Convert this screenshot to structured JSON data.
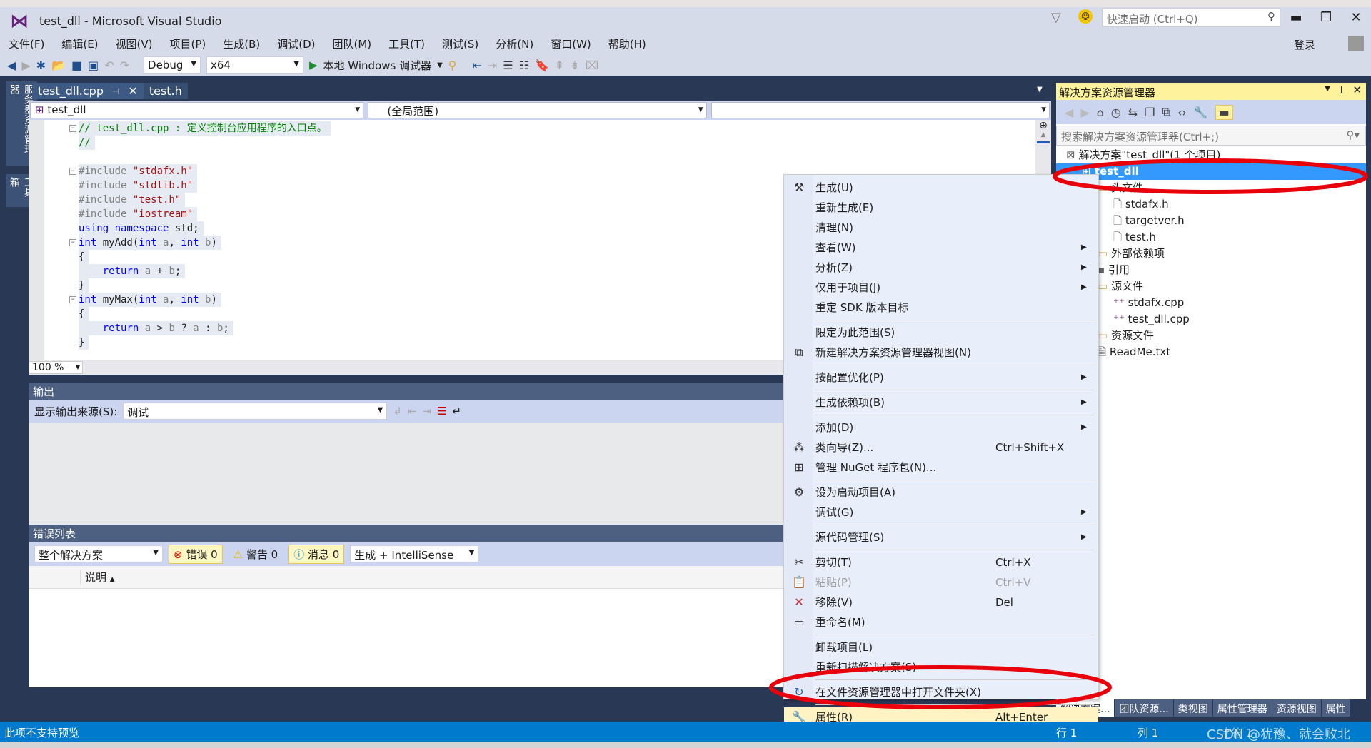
{
  "window": {
    "title": "test_dll - Microsoft Visual Studio",
    "quick_launch_placeholder": "快速启动 (Ctrl+Q)",
    "sign_in": "登录"
  },
  "menu": [
    "文件(F)",
    "编辑(E)",
    "视图(V)",
    "项目(P)",
    "生成(B)",
    "调试(D)",
    "团队(M)",
    "工具(T)",
    "测试(S)",
    "分析(N)",
    "窗口(W)",
    "帮助(H)"
  ],
  "toolbar": {
    "config": "Debug",
    "platform": "x64",
    "debugger": "本地 Windows 调试器"
  },
  "side_tabs": [
    "服务器资源管理器",
    "工具箱"
  ],
  "editor": {
    "tabs": [
      {
        "label": "test_dll.cpp",
        "active": true
      },
      {
        "label": "test.h",
        "active": false
      }
    ],
    "nav": {
      "project": "test_dll",
      "scope": "(全局范围)",
      "member": ""
    },
    "zoom": "100 %",
    "lines": [
      [
        [
          "cm",
          "// test_dll.cpp : 定义控制台应用程序的入口点。"
        ]
      ],
      [
        [
          "cm",
          "//"
        ]
      ],
      [],
      [
        [
          "pp",
          "#include "
        ],
        [
          "st",
          "\"stdafx.h\""
        ]
      ],
      [
        [
          "pp",
          "#include "
        ],
        [
          "st",
          "\"stdlib.h\""
        ]
      ],
      [
        [
          "pp",
          "#include "
        ],
        [
          "st",
          "\"test.h\""
        ]
      ],
      [
        [
          "pp",
          "#include "
        ],
        [
          "st",
          "\"iostream\""
        ]
      ],
      [
        [
          "kw",
          "using namespace "
        ],
        [
          "",
          "std;"
        ]
      ],
      [
        [
          "kw",
          "int "
        ],
        [
          "",
          "myAdd("
        ],
        [
          "kw",
          "int "
        ],
        [
          "pa",
          "a"
        ],
        [
          "",
          ", "
        ],
        [
          "kw",
          "int "
        ],
        [
          "pa",
          "b"
        ],
        [
          "",
          ")"
        ]
      ],
      [
        [
          "",
          "{"
        ]
      ],
      [
        [
          "",
          "    "
        ],
        [
          "kw",
          "return "
        ],
        [
          "pa",
          "a"
        ],
        [
          "",
          " + "
        ],
        [
          "pa",
          "b"
        ],
        [
          "",
          ";"
        ]
      ],
      [
        [
          "",
          "}"
        ]
      ],
      [
        [
          "kw",
          "int "
        ],
        [
          "",
          "myMax("
        ],
        [
          "kw",
          "int "
        ],
        [
          "pa",
          "a"
        ],
        [
          "",
          ", "
        ],
        [
          "kw",
          "int "
        ],
        [
          "pa",
          "b"
        ],
        [
          "",
          ")"
        ]
      ],
      [
        [
          "",
          "{"
        ]
      ],
      [
        [
          "",
          "    "
        ],
        [
          "kw",
          "return "
        ],
        [
          "pa",
          "a"
        ],
        [
          "",
          " > "
        ],
        [
          "pa",
          "b"
        ],
        [
          "",
          " ? "
        ],
        [
          "pa",
          "a"
        ],
        [
          "",
          " : "
        ],
        [
          "pa",
          "b"
        ],
        [
          "",
          ";"
        ]
      ],
      [
        [
          "",
          "}"
        ]
      ]
    ]
  },
  "output": {
    "title": "输出",
    "source_label": "显示输出来源(S):",
    "source": "调试"
  },
  "error_list": {
    "title": "错误列表",
    "scope": "整个解决方案",
    "errors": "错误 0",
    "warnings": "警告 0",
    "messages": "消息 0",
    "filter": "生成 + IntelliSense",
    "column": "说明"
  },
  "solution_explorer": {
    "title": "解决方案资源管理器",
    "search_placeholder": "搜索解决方案资源管理器(Ctrl+;)",
    "tree": [
      {
        "label": "解决方案\"test_dll\"(1 个项目)",
        "depth": 0,
        "icon": "solution-icon"
      },
      {
        "label": "test_dll",
        "depth": 1,
        "icon": "project-icon",
        "selected": true
      },
      {
        "label": "头文件",
        "depth": 2,
        "icon": "folder-icon"
      },
      {
        "label": "stdafx.h",
        "depth": 3,
        "icon": "header-file-icon"
      },
      {
        "label": "targetver.h",
        "depth": 3,
        "icon": "header-file-icon"
      },
      {
        "label": "test.h",
        "depth": 3,
        "icon": "header-file-icon"
      },
      {
        "label": "外部依赖项",
        "depth": 2,
        "icon": "folder-icon"
      },
      {
        "label": "引用",
        "depth": 2,
        "icon": "references-icon"
      },
      {
        "label": "源文件",
        "depth": 2,
        "icon": "folder-icon"
      },
      {
        "label": "stdafx.cpp",
        "depth": 3,
        "icon": "cpp-file-icon"
      },
      {
        "label": "test_dll.cpp",
        "depth": 3,
        "icon": "cpp-file-icon"
      },
      {
        "label": "资源文件",
        "depth": 2,
        "icon": "folder-icon"
      },
      {
        "label": "ReadMe.txt",
        "depth": 2,
        "icon": "text-file-icon"
      }
    ],
    "bottom_tabs": [
      "解决方案...",
      "团队资源...",
      "类视图",
      "属性管理器",
      "资源视图",
      "属性"
    ]
  },
  "context_menu": [
    {
      "label": "生成(U)",
      "icon": "build-icon"
    },
    {
      "label": "重新生成(E)"
    },
    {
      "label": "清理(N)"
    },
    {
      "label": "查看(W)",
      "submenu": true
    },
    {
      "label": "分析(Z)",
      "submenu": true
    },
    {
      "label": "仅用于项目(J)",
      "submenu": true
    },
    {
      "label": "重定 SDK 版本目标",
      "sep_after": true
    },
    {
      "label": "限定为此范围(S)"
    },
    {
      "label": "新建解决方案资源管理器视图(N)",
      "icon": "new-view-icon",
      "sep_after": true
    },
    {
      "label": "按配置优化(P)",
      "submenu": true,
      "sep_after": true
    },
    {
      "label": "生成依赖项(B)",
      "submenu": true,
      "sep_after": true
    },
    {
      "label": "添加(D)",
      "submenu": true
    },
    {
      "label": "类向导(Z)...",
      "shortcut": "Ctrl+Shift+X",
      "icon": "class-wizard-icon"
    },
    {
      "label": "管理 NuGet 程序包(N)...",
      "icon": "nuget-icon",
      "sep_after": true
    },
    {
      "label": "设为启动项目(A)",
      "icon": "gear-icon"
    },
    {
      "label": "调试(G)",
      "submenu": true,
      "sep_after": true
    },
    {
      "label": "源代码管理(S)",
      "submenu": true,
      "sep_after": true
    },
    {
      "label": "剪切(T)",
      "shortcut": "Ctrl+X",
      "icon": "scissors-icon"
    },
    {
      "label": "粘贴(P)",
      "shortcut": "Ctrl+V",
      "icon": "paste-icon",
      "disabled": true
    },
    {
      "label": "移除(V)",
      "shortcut": "Del",
      "icon": "remove-icon"
    },
    {
      "label": "重命名(M)",
      "icon": "rename-icon",
      "sep_after": true
    },
    {
      "label": "卸载项目(L)"
    },
    {
      "label": "重新扫描解决方案(S)",
      "sep_after": true
    },
    {
      "label": "在文件资源管理器中打开文件夹(X)",
      "icon": "open-folder-icon",
      "sep_after": true
    },
    {
      "label": "属性(R)",
      "shortcut": "Alt+Enter",
      "icon": "wrench-icon",
      "highlighted": true
    }
  ],
  "status": {
    "left": "此项不支持预览",
    "line": "行 1",
    "col": "列 1",
    "char": "字符 1",
    "watermark": "CSDN @犹豫、就会败北"
  },
  "colors": {
    "accent": "#007acc",
    "selection": "#3399ff",
    "annotation": "#e8000b",
    "chrome": "#293955",
    "panel_header": "#fff29d"
  }
}
